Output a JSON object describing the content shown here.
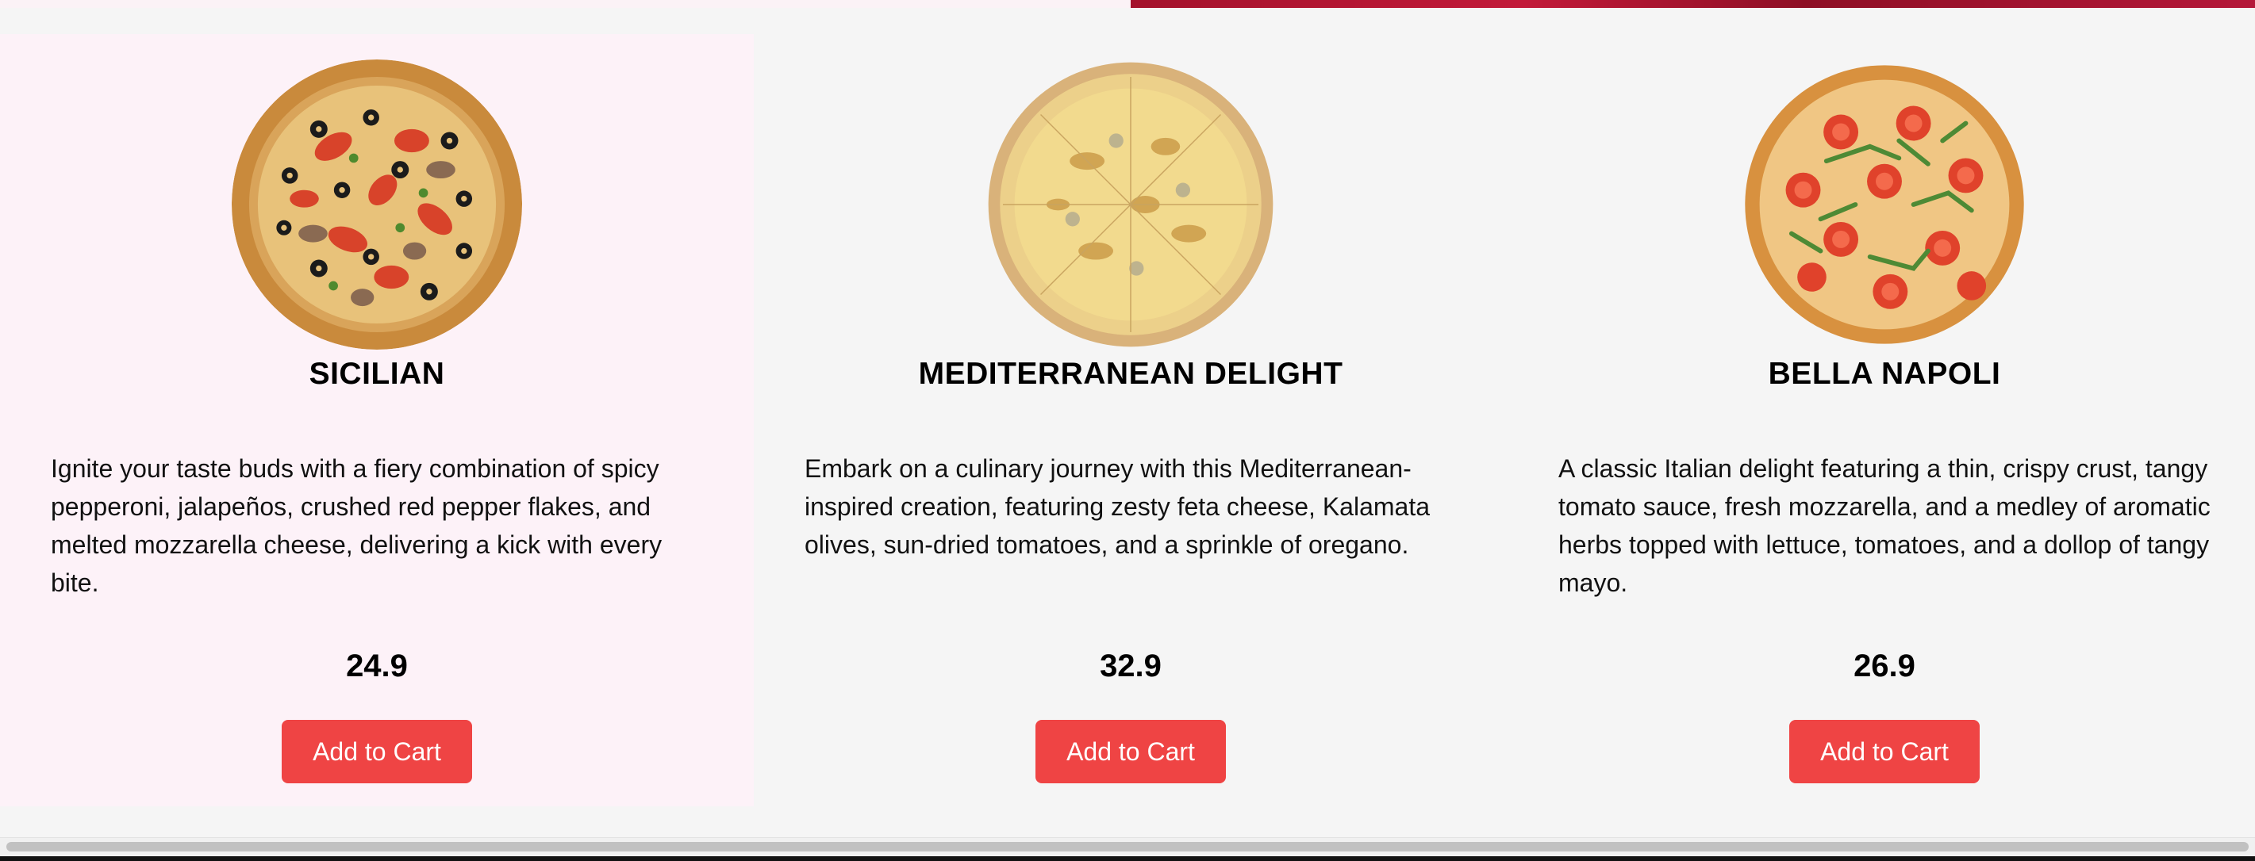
{
  "products": [
    {
      "name": "SICILIAN",
      "description": "Ignite your taste buds with a fiery combination of spicy pepperoni, jalapeños, crushed red pepper flakes, and melted mozzarella cheese, delivering a kick with every bite.",
      "price": "24.9",
      "button_label": "Add to Cart",
      "image_icon": "pizza-sicilian-image"
    },
    {
      "name": "MEDITERRANEAN DELIGHT",
      "description": "Embark on a culinary journey with this Mediterranean-inspired creation, featuring zesty feta cheese, Kalamata olives, sun-dried tomatoes, and a sprinkle of oregano.",
      "price": "32.9",
      "button_label": "Add to Cart",
      "image_icon": "pizza-mediterranean-image"
    },
    {
      "name": "BELLA NAPOLI",
      "description": "A classic Italian delight featuring a thin, crispy crust, tangy tomato sauce, fresh mozzarella, and a medley of aromatic herbs topped with lettuce, tomatoes, and a dollop of tangy mayo.",
      "price": "26.9",
      "button_label": "Add to Cart",
      "image_icon": "pizza-bella-napoli-image"
    }
  ],
  "colors": {
    "accent": "#ef4444",
    "highlight_card": "#fdf2f8",
    "banner": "#a3122c",
    "background": "#f5f5f5"
  }
}
